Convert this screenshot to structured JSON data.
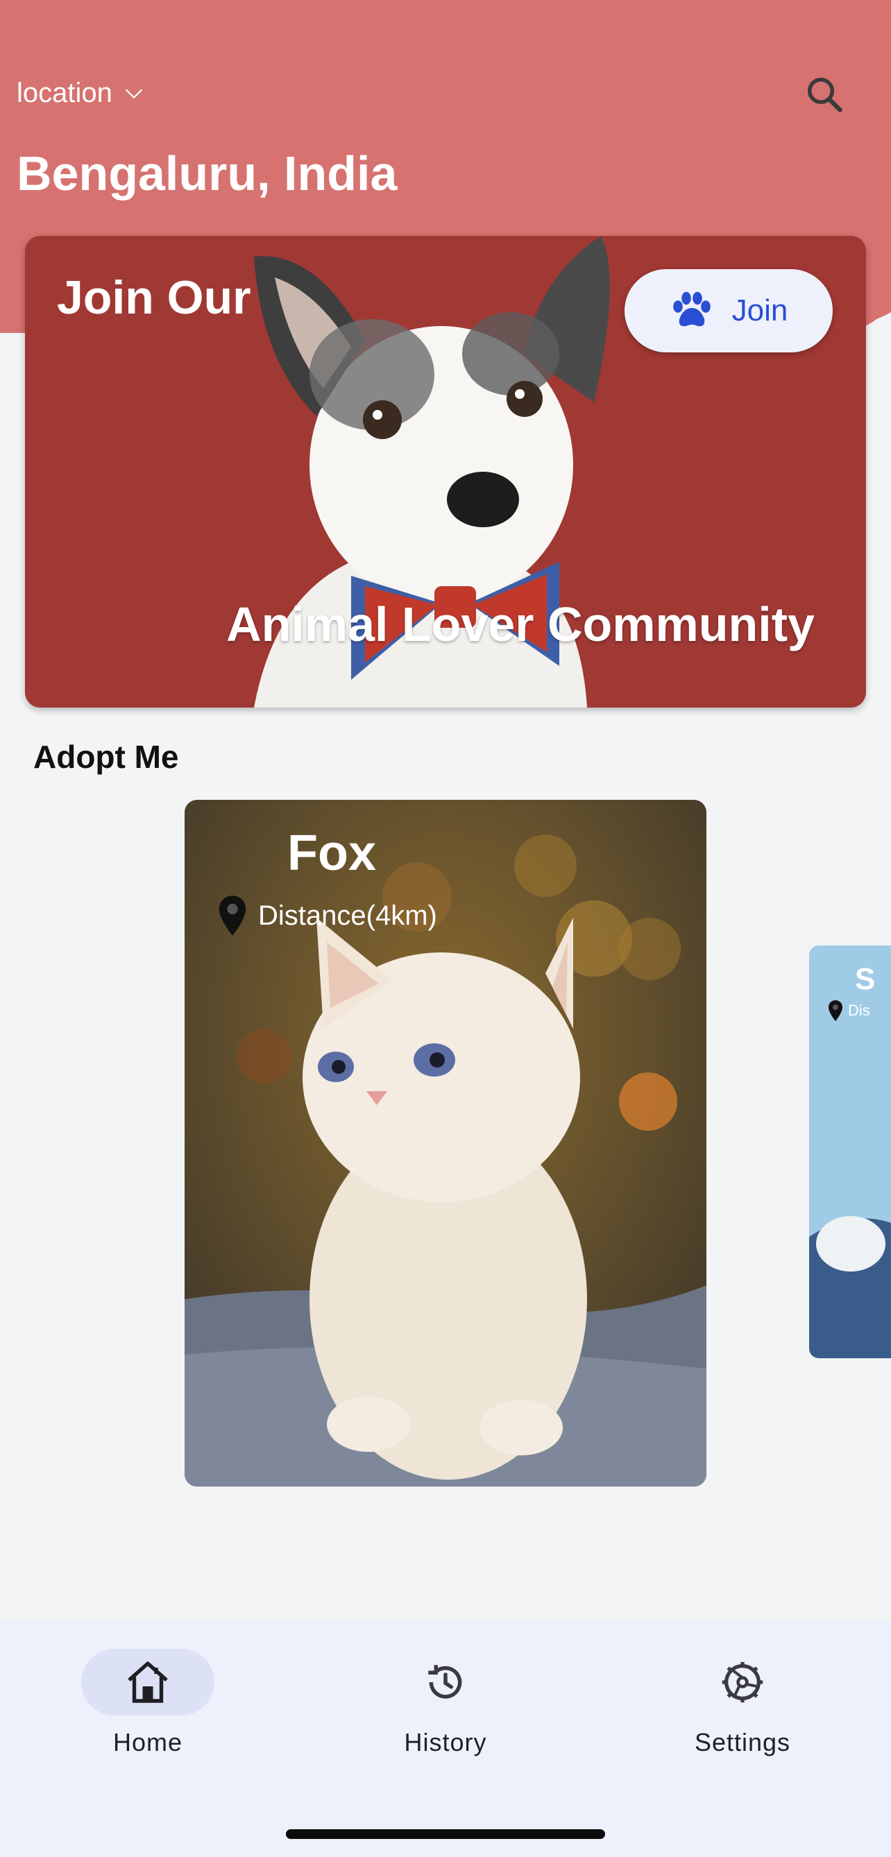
{
  "header": {
    "location_label": "location",
    "city": "Bengaluru, India",
    "icons": {
      "dropdown": "chevron-down-icon",
      "search": "search-icon"
    }
  },
  "banner": {
    "title": "Join Our",
    "subtitle": "Animal Lover Community",
    "join_label": "Join",
    "join_icon": "paw-icon",
    "colors": {
      "background": "#a03834",
      "button_text": "#2b4fd3"
    }
  },
  "adopt": {
    "section_title": "Adopt Me",
    "pets": [
      {
        "name": "Fox",
        "distance": "Distance(4km)",
        "icon": "location-pin-icon"
      },
      {
        "name": "S",
        "distance": "Dis",
        "icon": "location-pin-icon"
      }
    ]
  },
  "nav": {
    "items": [
      {
        "label": "Home",
        "icon": "home-icon",
        "active": true
      },
      {
        "label": "History",
        "icon": "history-icon",
        "active": false
      },
      {
        "label": "Settings",
        "icon": "settings-icon",
        "active": false
      }
    ]
  },
  "colors": {
    "header": "#d67270",
    "page": "#f3f4f6",
    "nav": "#eef1fb",
    "nav_active": "#dde1f5"
  }
}
